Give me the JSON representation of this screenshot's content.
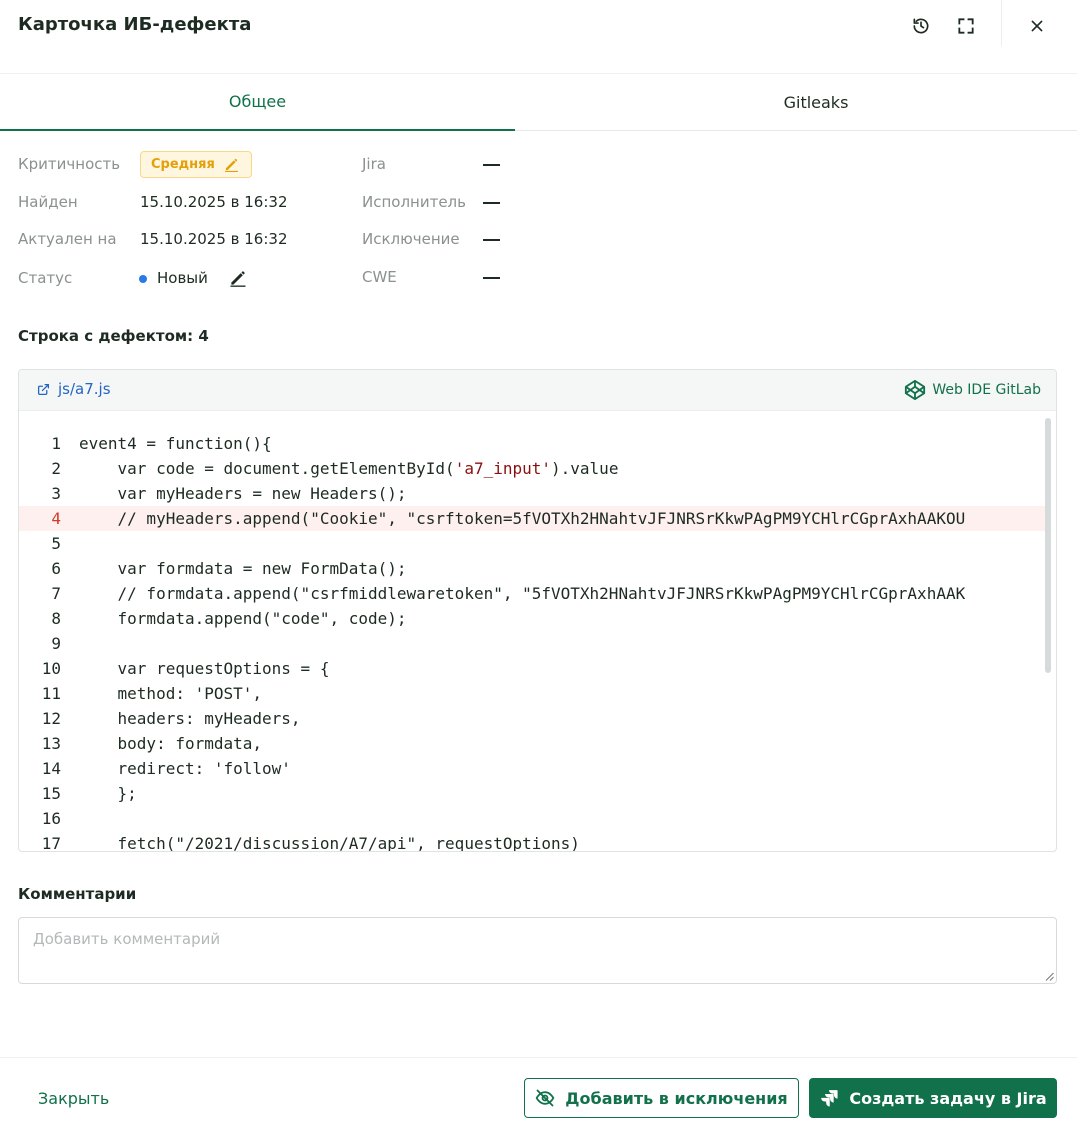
{
  "modal": {
    "title": "Карточка ИБ-дефекта"
  },
  "tabs": [
    {
      "label": "Общее",
      "active": true
    },
    {
      "label": "Gitleaks",
      "active": false
    }
  ],
  "properties": {
    "criticality_label": "Критичность",
    "criticality_value": "Средняя",
    "found_label": "Найден",
    "found_value": "15.10.2025 в 16:32",
    "actual_label": "Актуален на",
    "actual_value": "15.10.2025 в 16:32",
    "status_label": "Статус",
    "status_value": "Новый",
    "jira_label": "Jira",
    "assignee_label": "Исполнитель",
    "exception_label": "Исключение",
    "cwe_label": "CWE"
  },
  "defect_line": {
    "title": "Строка с дефектом: 4"
  },
  "code": {
    "file_name": "js/a7.js",
    "ide_label": "Web IDE GitLab",
    "highlight_line": 4,
    "lines": [
      {
        "n": "1",
        "text": "event4 = function(){"
      },
      {
        "n": "2",
        "pre": "    var code = document.getElementById(",
        "str": "'a7_input'",
        "post": ").value"
      },
      {
        "n": "3",
        "text": "    var myHeaders = new Headers();"
      },
      {
        "n": "4",
        "text": "    // myHeaders.append(\"Cookie\", \"csrftoken=5fVOTXh2HNahtvJFJNRSrKkwPAgPM9YCHlrCGprAxhAAKOU"
      },
      {
        "n": "5",
        "text": ""
      },
      {
        "n": "6",
        "text": "    var formdata = new FormData();"
      },
      {
        "n": "7",
        "text": "    // formdata.append(\"csrfmiddlewaretoken\", \"5fVOTXh2HNahtvJFJNRSrKkwPAgPM9YCHlrCGprAxhAAK"
      },
      {
        "n": "8",
        "text": "    formdata.append(\"code\", code);"
      },
      {
        "n": "9",
        "text": ""
      },
      {
        "n": "10",
        "text": "    var requestOptions = {"
      },
      {
        "n": "11",
        "text": "    method: 'POST',"
      },
      {
        "n": "12",
        "text": "    headers: myHeaders,"
      },
      {
        "n": "13",
        "text": "    body: formdata,"
      },
      {
        "n": "14",
        "text": "    redirect: 'follow'"
      },
      {
        "n": "15",
        "text": "    };"
      },
      {
        "n": "16",
        "text": ""
      },
      {
        "n": "17",
        "text": "    fetch(\"/2021/discussion/A7/api\", requestOptions)"
      }
    ]
  },
  "comments": {
    "title": "Комментарии",
    "placeholder": "Добавить комментарий",
    "value": ""
  },
  "footer": {
    "close_label": "Закрыть",
    "add_exception_label": "Добавить в исключения",
    "create_task_label": "Создать задачу в Jira"
  },
  "colors": {
    "accent": "#11714b",
    "criticality_medium": "#e3a008",
    "status_new": "#2979e6",
    "highlight_row": "#fdf0ee"
  },
  "icons": {
    "history": "history-icon",
    "fullscreen": "fullscreen-icon",
    "close": "close-icon",
    "edit": "pencil-icon",
    "external_link": "external-link-icon",
    "gitlab_ide": "codepen-cube-icon",
    "hide": "eye-off-icon",
    "jira": "jira-icon"
  }
}
